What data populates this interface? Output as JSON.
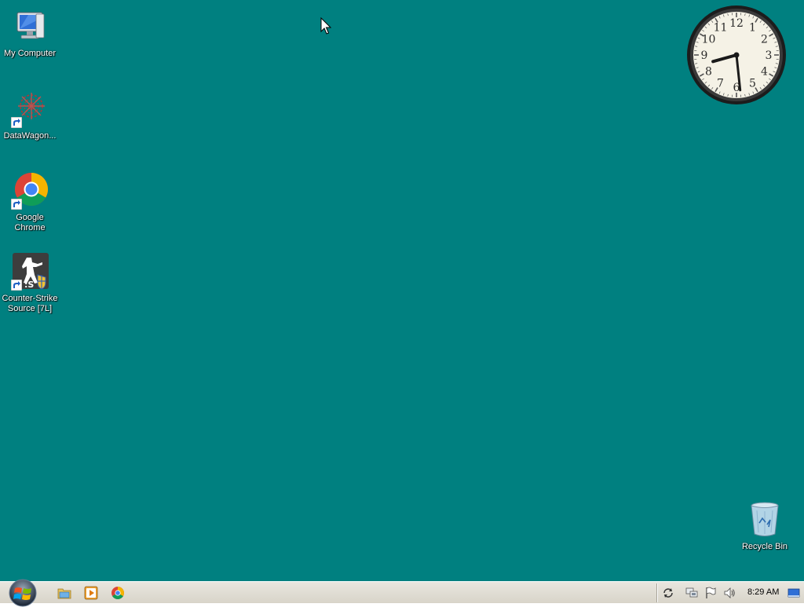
{
  "desktop": {
    "background_color": "#008080",
    "icons": [
      {
        "name": "my-computer",
        "label": "My Computer",
        "icon": "computer-icon",
        "shortcut": false
      },
      {
        "name": "datawagon",
        "label": "DataWagon...",
        "icon": "datawagon-icon",
        "shortcut": true
      },
      {
        "name": "google-chrome",
        "label": "Google Chrome",
        "icon": "chrome-icon",
        "shortcut": true
      },
      {
        "name": "counter-strike",
        "label": "Counter-Strike Source [7L]",
        "icon": "counter-strike-icon",
        "shortcut": true
      },
      {
        "name": "recycle-bin",
        "label": "Recycle Bin",
        "icon": "recycle-bin-icon",
        "shortcut": false
      }
    ]
  },
  "clock_gadget": {
    "time": "8:29",
    "numerals": [
      "12",
      "1",
      "2",
      "3",
      "4",
      "5",
      "6",
      "7",
      "8",
      "9",
      "10",
      "11"
    ]
  },
  "taskbar": {
    "start_button": {
      "icon": "windows-orb-icon"
    },
    "quick_launch": [
      {
        "name": "explorer",
        "icon": "explorer-icon"
      },
      {
        "name": "media-player",
        "icon": "media-player-icon"
      },
      {
        "name": "chrome",
        "icon": "chrome-icon"
      }
    ],
    "tray": {
      "icons": [
        "sync-icon",
        "network-icon",
        "flag-icon",
        "volume-icon",
        "show-desktop-icon"
      ],
      "time": "8:29 AM"
    }
  },
  "colors": {
    "taskbar": "#dcd8cd",
    "label_text": "#ffffff",
    "accent_blue": "#3b6fd8"
  }
}
